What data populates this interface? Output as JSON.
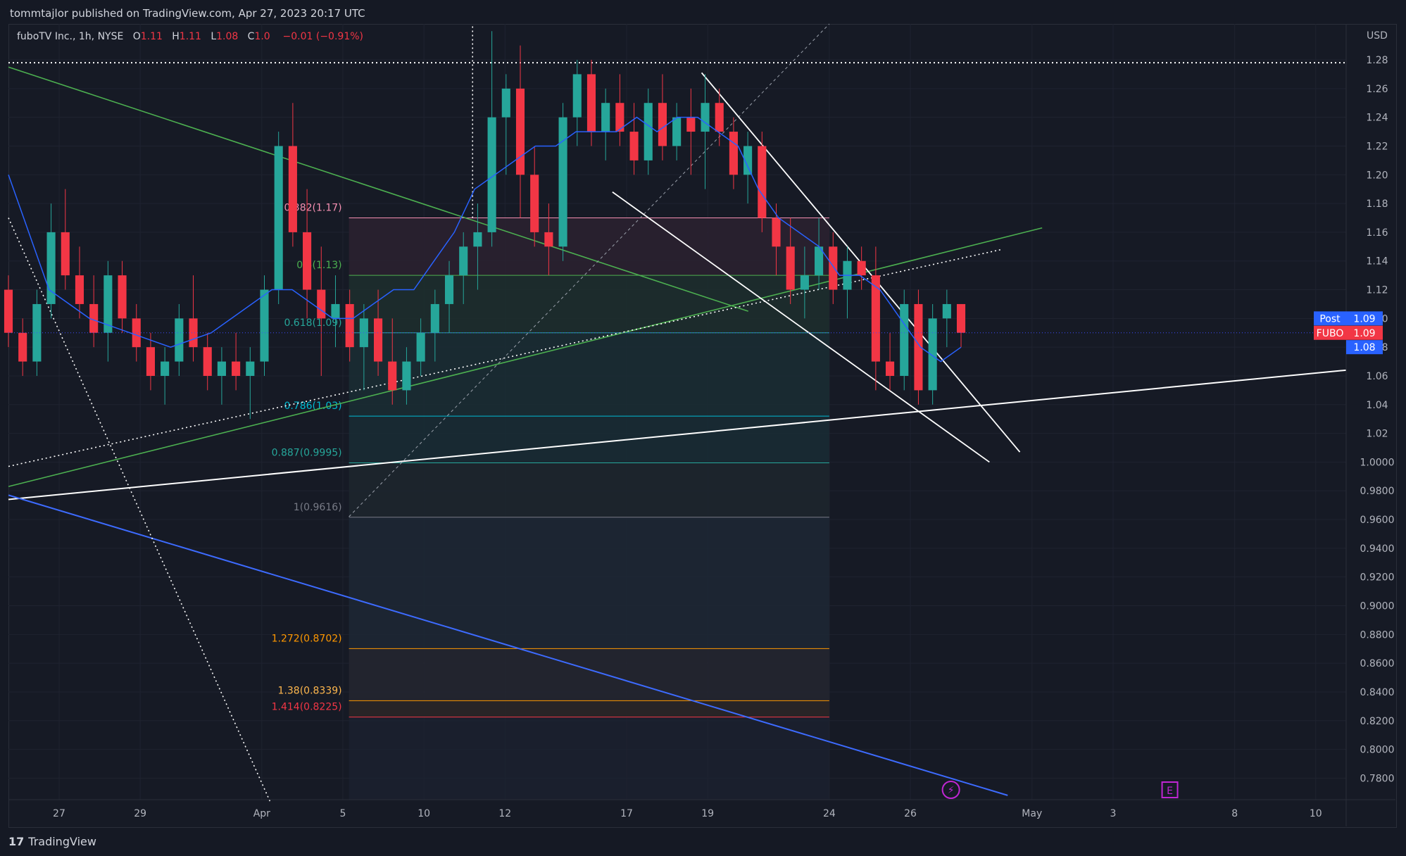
{
  "header": {
    "published": "tommtajlor published on TradingView.com, Apr 27, 2023 20:17 UTC"
  },
  "legend": {
    "symbol": "fuboTV Inc., 1h, NYSE",
    "o_label": "O",
    "o_value": "1.11",
    "h_label": "H",
    "h_value": "1.11",
    "l_label": "L",
    "l_value": "1.08",
    "c_label": "C",
    "c_value": "1.0",
    "change": "−0.01 (−0.91%)"
  },
  "footer": {
    "logo": "17",
    "brand": "TradingView"
  },
  "colors": {
    "bg": "#161a25",
    "up": "#26a69a",
    "down": "#f23645",
    "ma": "#2962ff",
    "green_line": "#4caf50",
    "grid": "#1f2330",
    "text": "#b2b5be"
  },
  "chart_data": {
    "type": "candlestick",
    "title": "fuboTV Inc., 1h, NYSE",
    "currency_label": "USD",
    "ylim": [
      0.765,
      1.305
    ],
    "y_ticks": [
      "1.28",
      "1.26",
      "1.24",
      "1.22",
      "1.20",
      "1.18",
      "1.16",
      "1.14",
      "1.12",
      "1.10",
      "1.08",
      "1.06",
      "1.04",
      "1.02",
      "1.0000",
      "0.9800",
      "0.9600",
      "0.9400",
      "0.9200",
      "0.9000",
      "0.8800",
      "0.8600",
      "0.8400",
      "0.8200",
      "0.8000",
      "0.7800"
    ],
    "x_ticks": [
      {
        "label": "27",
        "t": 2.5
      },
      {
        "label": "29",
        "t": 6.5
      },
      {
        "label": "Apr",
        "t": 12.5
      },
      {
        "label": "5",
        "t": 16.5
      },
      {
        "label": "10",
        "t": 20.5
      },
      {
        "label": "12",
        "t": 24.5
      },
      {
        "label": "17",
        "t": 30.5
      },
      {
        "label": "19",
        "t": 34.5
      },
      {
        "label": "24",
        "t": 40.5
      },
      {
        "label": "26",
        "t": 44.5
      },
      {
        "label": "May",
        "t": 50.5
      },
      {
        "label": "3",
        "t": 54.5
      },
      {
        "label": "8",
        "t": 60.5
      },
      {
        "label": "10",
        "t": 64.5
      }
    ],
    "price_badges": [
      {
        "label": "Post",
        "value": "1.09",
        "color": "#2962ff",
        "y": 1.1
      },
      {
        "label": "FUBO",
        "value": "1.09",
        "color": "#f23645",
        "y": 1.09
      },
      {
        "label": "",
        "value": "1.08",
        "color": "#2962ff",
        "y": 1.08
      }
    ],
    "fibonacci": [
      {
        "label": "0.382(1.17)",
        "price": 1.17,
        "color": "#f48fb1",
        "label_color": "#f48fb1"
      },
      {
        "label": "0.5(1.13)",
        "price": 1.13,
        "color": "#4caf50",
        "label_color": "#4caf50"
      },
      {
        "label": "0.618(1.09)",
        "price": 1.09,
        "color": "#26a69a",
        "label_color": "#26a69a"
      },
      {
        "label": "0.786(1.03)",
        "price": 1.032,
        "color": "#00bcd4",
        "label_color": "#00bcd4"
      },
      {
        "label": "0.887(0.9995)",
        "price": 0.9995,
        "color": "#26a69a",
        "label_color": "#26a69a"
      },
      {
        "label": "1(0.9616)",
        "price": 0.9616,
        "color": "#787b86",
        "label_color": "#787b86"
      },
      {
        "label": "1.272(0.8702)",
        "price": 0.8702,
        "color": "#ff9800",
        "label_color": "#ff9800"
      },
      {
        "label": "1.38(0.8339)",
        "price": 0.8339,
        "color": "#ff9800",
        "label_color": "#ffb74d"
      },
      {
        "label": "1.414(0.8225)",
        "price": 0.8225,
        "color": "#f23645",
        "label_color": "#f23645"
      }
    ],
    "fib_range": {
      "t_start": 16.8,
      "t_end": 40.5
    },
    "candles": [
      [
        1.12,
        1.13,
        1.08,
        1.09
      ],
      [
        1.09,
        1.1,
        1.06,
        1.07
      ],
      [
        1.07,
        1.12,
        1.06,
        1.11
      ],
      [
        1.11,
        1.18,
        1.1,
        1.16
      ],
      [
        1.16,
        1.19,
        1.12,
        1.13
      ],
      [
        1.13,
        1.15,
        1.1,
        1.11
      ],
      [
        1.11,
        1.13,
        1.08,
        1.09
      ],
      [
        1.09,
        1.14,
        1.07,
        1.13
      ],
      [
        1.13,
        1.14,
        1.09,
        1.1
      ],
      [
        1.1,
        1.11,
        1.07,
        1.08
      ],
      [
        1.08,
        1.09,
        1.05,
        1.06
      ],
      [
        1.06,
        1.08,
        1.04,
        1.07
      ],
      [
        1.07,
        1.11,
        1.06,
        1.1
      ],
      [
        1.1,
        1.13,
        1.07,
        1.08
      ],
      [
        1.08,
        1.09,
        1.05,
        1.06
      ],
      [
        1.06,
        1.08,
        1.04,
        1.07
      ],
      [
        1.07,
        1.09,
        1.05,
        1.06
      ],
      [
        1.06,
        1.08,
        1.03,
        1.07
      ],
      [
        1.07,
        1.13,
        1.06,
        1.12
      ],
      [
        1.12,
        1.23,
        1.11,
        1.22
      ],
      [
        1.22,
        1.25,
        1.15,
        1.16
      ],
      [
        1.16,
        1.19,
        1.1,
        1.12
      ],
      [
        1.12,
        1.15,
        1.06,
        1.1
      ],
      [
        1.1,
        1.13,
        1.08,
        1.11
      ],
      [
        1.11,
        1.12,
        1.07,
        1.08
      ],
      [
        1.08,
        1.11,
        1.05,
        1.1
      ],
      [
        1.1,
        1.12,
        1.06,
        1.07
      ],
      [
        1.07,
        1.1,
        1.04,
        1.05
      ],
      [
        1.05,
        1.08,
        1.04,
        1.07
      ],
      [
        1.07,
        1.1,
        1.06,
        1.09
      ],
      [
        1.09,
        1.12,
        1.07,
        1.11
      ],
      [
        1.11,
        1.14,
        1.09,
        1.13
      ],
      [
        1.13,
        1.16,
        1.11,
        1.15
      ],
      [
        1.15,
        1.18,
        1.12,
        1.16
      ],
      [
        1.16,
        1.3,
        1.15,
        1.24
      ],
      [
        1.24,
        1.27,
        1.2,
        1.26
      ],
      [
        1.26,
        1.29,
        1.17,
        1.2
      ],
      [
        1.2,
        1.22,
        1.15,
        1.16
      ],
      [
        1.16,
        1.18,
        1.13,
        1.15
      ],
      [
        1.15,
        1.25,
        1.14,
        1.24
      ],
      [
        1.24,
        1.28,
        1.22,
        1.27
      ],
      [
        1.27,
        1.28,
        1.22,
        1.23
      ],
      [
        1.23,
        1.26,
        1.21,
        1.25
      ],
      [
        1.25,
        1.27,
        1.22,
        1.23
      ],
      [
        1.23,
        1.25,
        1.2,
        1.21
      ],
      [
        1.21,
        1.26,
        1.2,
        1.25
      ],
      [
        1.25,
        1.27,
        1.21,
        1.22
      ],
      [
        1.22,
        1.25,
        1.21,
        1.24
      ],
      [
        1.24,
        1.26,
        1.2,
        1.23
      ],
      [
        1.23,
        1.27,
        1.19,
        1.25
      ],
      [
        1.25,
        1.26,
        1.22,
        1.23
      ],
      [
        1.23,
        1.24,
        1.19,
        1.2
      ],
      [
        1.2,
        1.23,
        1.18,
        1.22
      ],
      [
        1.22,
        1.23,
        1.16,
        1.17
      ],
      [
        1.17,
        1.18,
        1.13,
        1.15
      ],
      [
        1.15,
        1.17,
        1.11,
        1.12
      ],
      [
        1.12,
        1.15,
        1.1,
        1.13
      ],
      [
        1.13,
        1.17,
        1.12,
        1.15
      ],
      [
        1.15,
        1.16,
        1.11,
        1.12
      ],
      [
        1.12,
        1.15,
        1.1,
        1.14
      ],
      [
        1.14,
        1.15,
        1.12,
        1.13
      ],
      [
        1.13,
        1.15,
        1.05,
        1.07
      ],
      [
        1.07,
        1.09,
        1.05,
        1.06
      ],
      [
        1.06,
        1.12,
        1.05,
        1.11
      ],
      [
        1.11,
        1.12,
        1.04,
        1.05
      ],
      [
        1.05,
        1.11,
        1.04,
        1.1
      ],
      [
        1.1,
        1.12,
        1.08,
        1.11
      ],
      [
        1.11,
        1.11,
        1.08,
        1.09
      ]
    ],
    "moving_average": [
      [
        0,
        1.2
      ],
      [
        2,
        1.12
      ],
      [
        4,
        1.1
      ],
      [
        6,
        1.09
      ],
      [
        8,
        1.08
      ],
      [
        10,
        1.09
      ],
      [
        11,
        1.1
      ],
      [
        12,
        1.11
      ],
      [
        13,
        1.12
      ],
      [
        14,
        1.12
      ],
      [
        15,
        1.11
      ],
      [
        16,
        1.1
      ],
      [
        17,
        1.1
      ],
      [
        18,
        1.11
      ],
      [
        19,
        1.12
      ],
      [
        20,
        1.12
      ],
      [
        21,
        1.14
      ],
      [
        22,
        1.16
      ],
      [
        23,
        1.19
      ],
      [
        24,
        1.2
      ],
      [
        25,
        1.21
      ],
      [
        26,
        1.22
      ],
      [
        27,
        1.22
      ],
      [
        28,
        1.23
      ],
      [
        30,
        1.23
      ],
      [
        31,
        1.24
      ],
      [
        32,
        1.23
      ],
      [
        33,
        1.24
      ],
      [
        34,
        1.24
      ],
      [
        35,
        1.23
      ],
      [
        36,
        1.22
      ],
      [
        37,
        1.19
      ],
      [
        38,
        1.17
      ],
      [
        39,
        1.16
      ],
      [
        40,
        1.15
      ],
      [
        41,
        1.13
      ],
      [
        42,
        1.13
      ],
      [
        43,
        1.12
      ],
      [
        44,
        1.1
      ],
      [
        45,
        1.08
      ],
      [
        46,
        1.07
      ],
      [
        47,
        1.08
      ]
    ]
  }
}
